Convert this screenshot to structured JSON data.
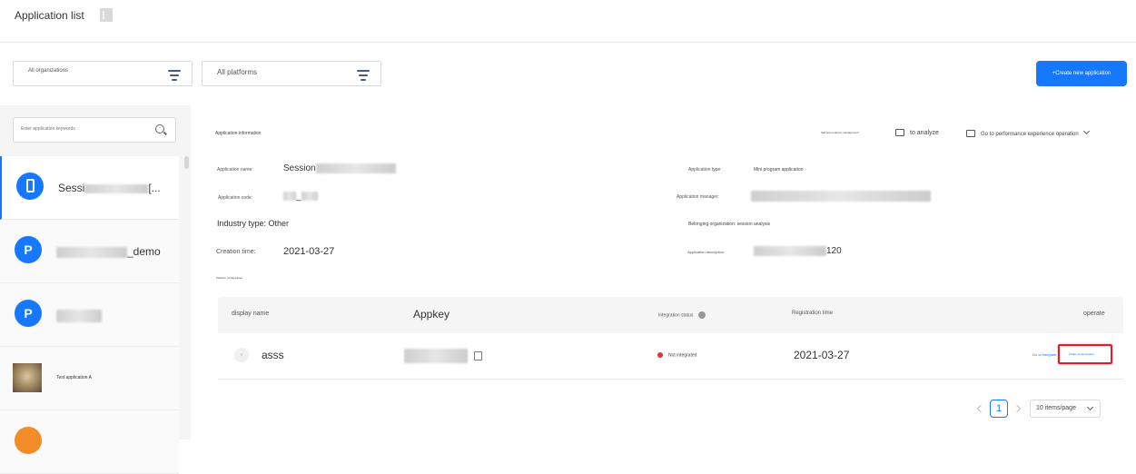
{
  "header": {
    "title": "Application list",
    "icon": "document-icon"
  },
  "filters": {
    "organization": "All organizations",
    "platform": "All platforms",
    "filter_icon": "filter-lines-icon"
  },
  "create_button": "+Create new application",
  "sidebar": {
    "search_placeholder": "Enter application keywords",
    "apps": [
      {
        "name": "Sessi",
        "name_suffix": "[...",
        "icon": "phone-icon",
        "active": true
      },
      {
        "name": "_demo",
        "icon_letter": "P"
      },
      {
        "name": "",
        "icon_letter": "P"
      },
      {
        "name": "Test application A",
        "icon": "photo-avatar"
      },
      {
        "name": "",
        "icon": "app-icon"
      }
    ]
  },
  "app_info": {
    "section_title": "Application information",
    "self_test": "Self test endpoint management",
    "to_analyze": "to analyze",
    "go_performance": "Go to performance experience operation",
    "name_label": "Application name:",
    "name_value": "Session",
    "code_label": "Application code:",
    "code_value": "_",
    "industry": "Industry type: Other",
    "creation_label": "Creation time:",
    "creation_value": "2021-03-27",
    "type_label": "Application type:",
    "type_value": "Mini program application",
    "manager_label": "Application manager:",
    "org": "Belonging organization: session analysis",
    "desc_label": "Application description:",
    "desc_value": "120"
  },
  "platform": {
    "section_title": "Platform configuration",
    "columns": {
      "display_name": "display name",
      "appkey": "Appkey",
      "integration_status": "Integration status",
      "registration_time": "Registration time",
      "operate": "operate"
    },
    "rows": [
      {
        "type_badge": "Y",
        "display_name": "asss",
        "status": "Not integrated",
        "status_color": "#e5322d",
        "registration_time": "2021-03-27",
        "action_integrate": "Go to integrate",
        "action_auth": "Initiate authentication"
      }
    ]
  },
  "pagination": {
    "current": "1",
    "page_size": "10 items/page"
  },
  "colors": {
    "primary": "#1677ff",
    "highlight": "#e11d2a"
  }
}
